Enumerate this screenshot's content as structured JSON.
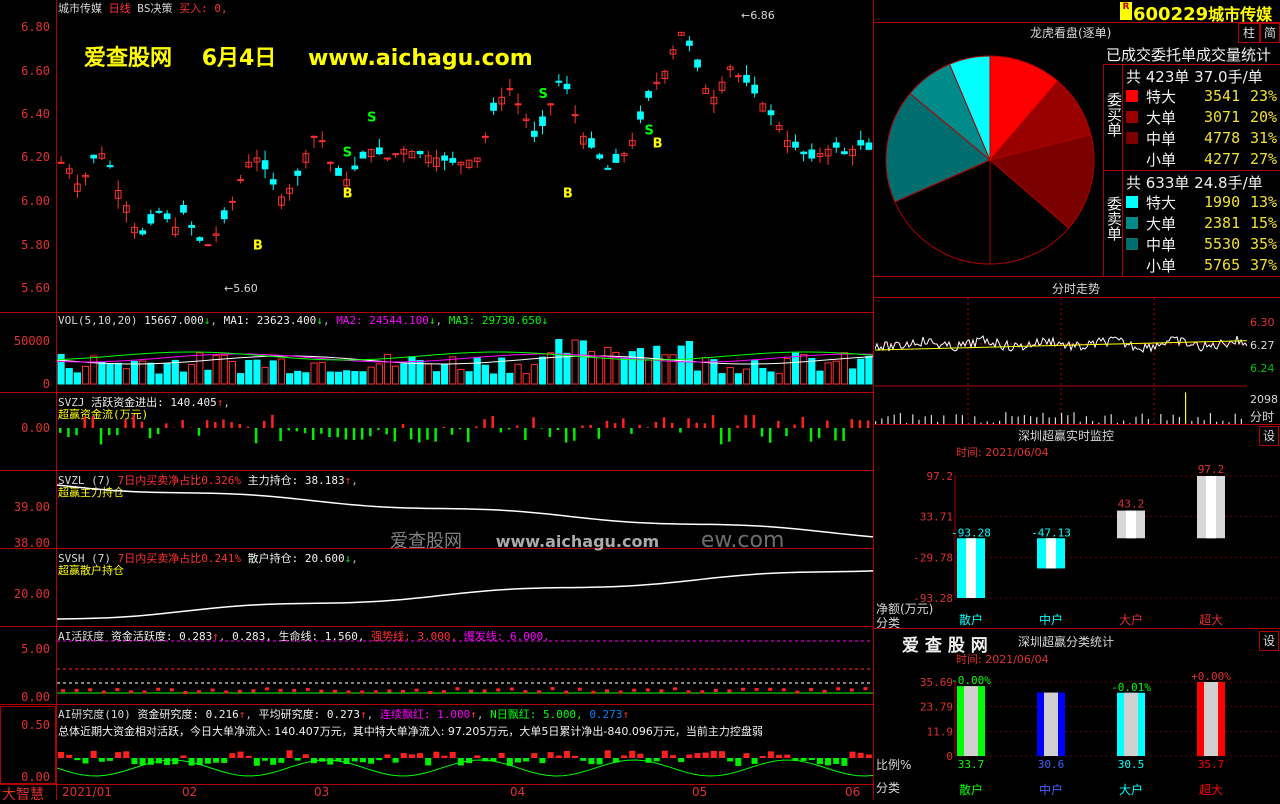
{
  "header": {
    "stock_name": "城市传媒",
    "period": "日线",
    "strategy": "BS决策",
    "buy_label": "买入: 0,",
    "code_badge": "R",
    "code": "600229",
    "name": "城市传媒",
    "btn_zhu": "柱",
    "btn_jian": "简"
  },
  "watermark": {
    "site": "爱查股网",
    "date": "6月4日",
    "url": "www.aichagu.com"
  },
  "center_watermark": {
    "site": "爱查股网",
    "url": "www.aichagu.com",
    "url2": "ew.com"
  },
  "price_panel": {
    "y_labels": [
      "6.80",
      "6.60",
      "6.40",
      "6.20",
      "6.00",
      "5.80",
      "5.60"
    ],
    "high_label": "6.86",
    "low_label": "5.60",
    "signal_b": "B",
    "signal_s": "S"
  },
  "vol_panel": {
    "title": "VOL(5,10,20)",
    "value": "15667.000",
    "ma1": "MA1: 23623.400",
    "ma2": "MA2: 24544.100",
    "ma3": "MA3: 29730.650",
    "y_labels": [
      "50000",
      "0"
    ]
  },
  "svzj_panel": {
    "title": "SVZJ",
    "text": "活跃资金进出: 140.405",
    "sub": "超赢资金流(万元)",
    "y_labels": [
      "0.00"
    ]
  },
  "svzl_panel": {
    "title": "SVZL (7)",
    "text1": "7日内买卖净占比0.326%",
    "text2": "主力持仓: 38.183",
    "sub": "超赢主力持仓",
    "y_labels": [
      "39.00",
      "38.00"
    ]
  },
  "svsh_panel": {
    "title": "SVSH (7)",
    "text1": "7日内买卖净占比0.241%",
    "text2": "散户持仓: 20.600",
    "sub": "超赢散户持仓",
    "y_labels": [
      "20.00"
    ]
  },
  "ai_active_panel": {
    "title": "AI活跃度",
    "t1": "资金活跃度: 0.283",
    "t2": "0.283,",
    "t3": "生命线: 1.560,",
    "t4": "强势线: 3.000,",
    "t5": "爆发线: 6.000,",
    "y_labels": [
      "5.00",
      "0.00"
    ]
  },
  "ai_research_panel": {
    "title": "AI研究度(10)",
    "t1": "资金研究度: 0.216",
    "t2": "平均研究度: 0.273",
    "t3": "连续飘红: 1.000",
    "t4": "N日飘红: 5.000,",
    "t5": "0.273",
    "summary": "总体近期大资金相对活跃，今日大单净流入: 140.407万元，其中特大单净流入: 97.205万元，大单5日累计净出-840.096万元，当前主力控盘弱",
    "y_labels": [
      "0.50",
      "0.00"
    ]
  },
  "footer": {
    "brand": "大智慧",
    "dates": [
      "2021/01",
      "02",
      "03",
      "04",
      "05",
      "06"
    ]
  },
  "longhu": {
    "title": "龙虎看盘(逐单)",
    "subtitle": "已成交委托单成交量统计",
    "buy_label": "委买单",
    "sell_label": "委卖单",
    "buy_total": "共 423单 37.0手/单",
    "sell_total": "共 633单 24.8手/单",
    "buy_rows": [
      {
        "label": "特大",
        "value": "3541",
        "pct": "23%",
        "color": "#ff0000"
      },
      {
        "label": "大单",
        "value": "3071",
        "pct": "20%",
        "color": "#990000"
      },
      {
        "label": "中单",
        "value": "4778",
        "pct": "31%",
        "color": "#7a0000"
      },
      {
        "label": "小单",
        "value": "4277",
        "pct": "27%",
        "color": "#000000"
      }
    ],
    "sell_rows": [
      {
        "label": "特大",
        "value": "1990",
        "pct": "13%",
        "color": "#00ffff"
      },
      {
        "label": "大单",
        "value": "2381",
        "pct": "15%",
        "color": "#008b8b"
      },
      {
        "label": "中单",
        "value": "5530",
        "pct": "35%",
        "color": "#006e6e"
      },
      {
        "label": "小单",
        "value": "5765",
        "pct": "37%",
        "color": "#000000"
      }
    ]
  },
  "intraday": {
    "title": "分时走势",
    "y_labels": [
      "6.30",
      "6.27",
      "6.24"
    ],
    "vol_label": "2098",
    "time_label": "分时"
  },
  "monitor": {
    "title": "深圳超赢实时监控",
    "set": "设",
    "time": "时间: 2021/06/04",
    "y_labels": [
      "97.2",
      "33.71",
      "-29.78",
      "-93.28"
    ],
    "unit": "净额(万元)",
    "cat_label": "分类",
    "categories": [
      "散户",
      "中户",
      "大户",
      "超大"
    ],
    "values": [
      -93.28,
      -47.13,
      43.2,
      97.2
    ],
    "value_labels": [
      "-93.28",
      "-47.13",
      "43.2",
      "97.2"
    ]
  },
  "classify": {
    "brand": "爱 查 股 网",
    "title": "深圳超赢分类统计",
    "set": "设",
    "time": "时间: 2021/06/04",
    "y_labels": [
      "35.69",
      "23.79",
      "11.9",
      "0"
    ],
    "ratio_label": "比例%",
    "cat_label": "分类",
    "categories": [
      "散户",
      "中户",
      "大户",
      "超大"
    ],
    "values": [
      33.7,
      30.6,
      30.5,
      35.7
    ],
    "change_labels": [
      "-0.00%",
      "",
      "-0.01%",
      "+0.00%"
    ],
    "colors": [
      "#00ff00",
      "#0000ff",
      "#00ffff",
      "#ff0000"
    ]
  }
}
